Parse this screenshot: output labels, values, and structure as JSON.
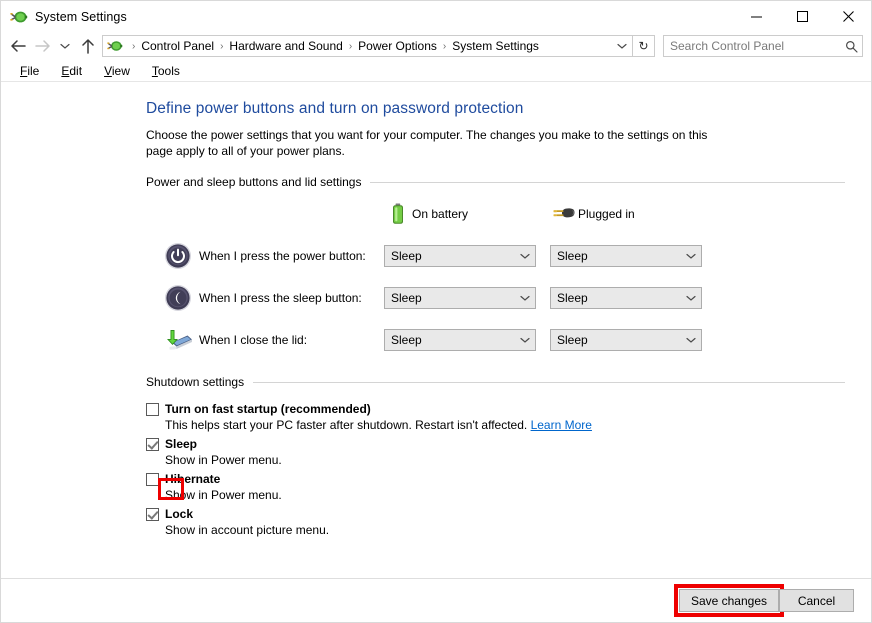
{
  "window": {
    "title": "System Settings",
    "icon": "power-options-icon",
    "caption": {
      "minimize": "minimize-icon",
      "maximize": "maximize-icon",
      "close": "close-icon"
    }
  },
  "addressbar": {
    "back": "back-arrow-icon",
    "forward": "forward-arrow-icon",
    "history": "chevron-down-icon",
    "up": "up-arrow-icon",
    "breadcrumbs": [
      "Control Panel",
      "Hardware and Sound",
      "Power Options",
      "System Settings"
    ],
    "separator": "›",
    "dropdown": "chevron-down-icon",
    "refresh": "↻",
    "search": {
      "placeholder": "Search Control Panel",
      "icon": "search-icon"
    }
  },
  "menubar": {
    "items": [
      {
        "accel": "F",
        "rest": "ile"
      },
      {
        "accel": "E",
        "rest": "dit"
      },
      {
        "accel": "V",
        "rest": "iew"
      },
      {
        "accel": "T",
        "rest": "ools"
      }
    ]
  },
  "page": {
    "title": "Define power buttons and turn on password protection",
    "description": "Choose the power settings that you want for your computer. The changes you make to the settings on this page apply to all of your power plans."
  },
  "power_section": {
    "header": "Power and sleep buttons and lid settings",
    "columns": [
      {
        "label": "On battery",
        "icon": "battery-icon"
      },
      {
        "label": "Plugged in",
        "icon": "power-plug-icon"
      }
    ],
    "rows": [
      {
        "icon": "power-button-icon",
        "label": "When I press the power button:",
        "on_battery": "Sleep",
        "plugged_in": "Sleep"
      },
      {
        "icon": "sleep-button-icon",
        "label": "When I press the sleep button:",
        "on_battery": "Sleep",
        "plugged_in": "Sleep"
      },
      {
        "icon": "close-lid-icon",
        "label": "When I close the lid:",
        "on_battery": "Sleep",
        "plugged_in": "Sleep"
      }
    ]
  },
  "shutdown_section": {
    "header": "Shutdown settings",
    "options": [
      {
        "label": "Turn on fast startup (recommended)",
        "checked": false,
        "description": "This helps start your PC faster after shutdown. Restart isn't affected.",
        "link": "Learn More",
        "highlighted": true
      },
      {
        "label": "Sleep",
        "checked": true,
        "description": "Show in Power menu.",
        "link": "",
        "highlighted": false
      },
      {
        "label": "Hibernate",
        "checked": false,
        "description": "Show in Power menu.",
        "link": "",
        "highlighted": false
      },
      {
        "label": "Lock",
        "checked": true,
        "description": "Show in account picture menu.",
        "link": "",
        "highlighted": false
      }
    ]
  },
  "footer": {
    "save_label": "Save changes",
    "cancel_label": "Cancel"
  },
  "colors": {
    "title_blue": "#1f4b9e",
    "link_blue": "#0066cc",
    "highlight_red": "#ee0000",
    "battery_green": "#5cb82e"
  }
}
